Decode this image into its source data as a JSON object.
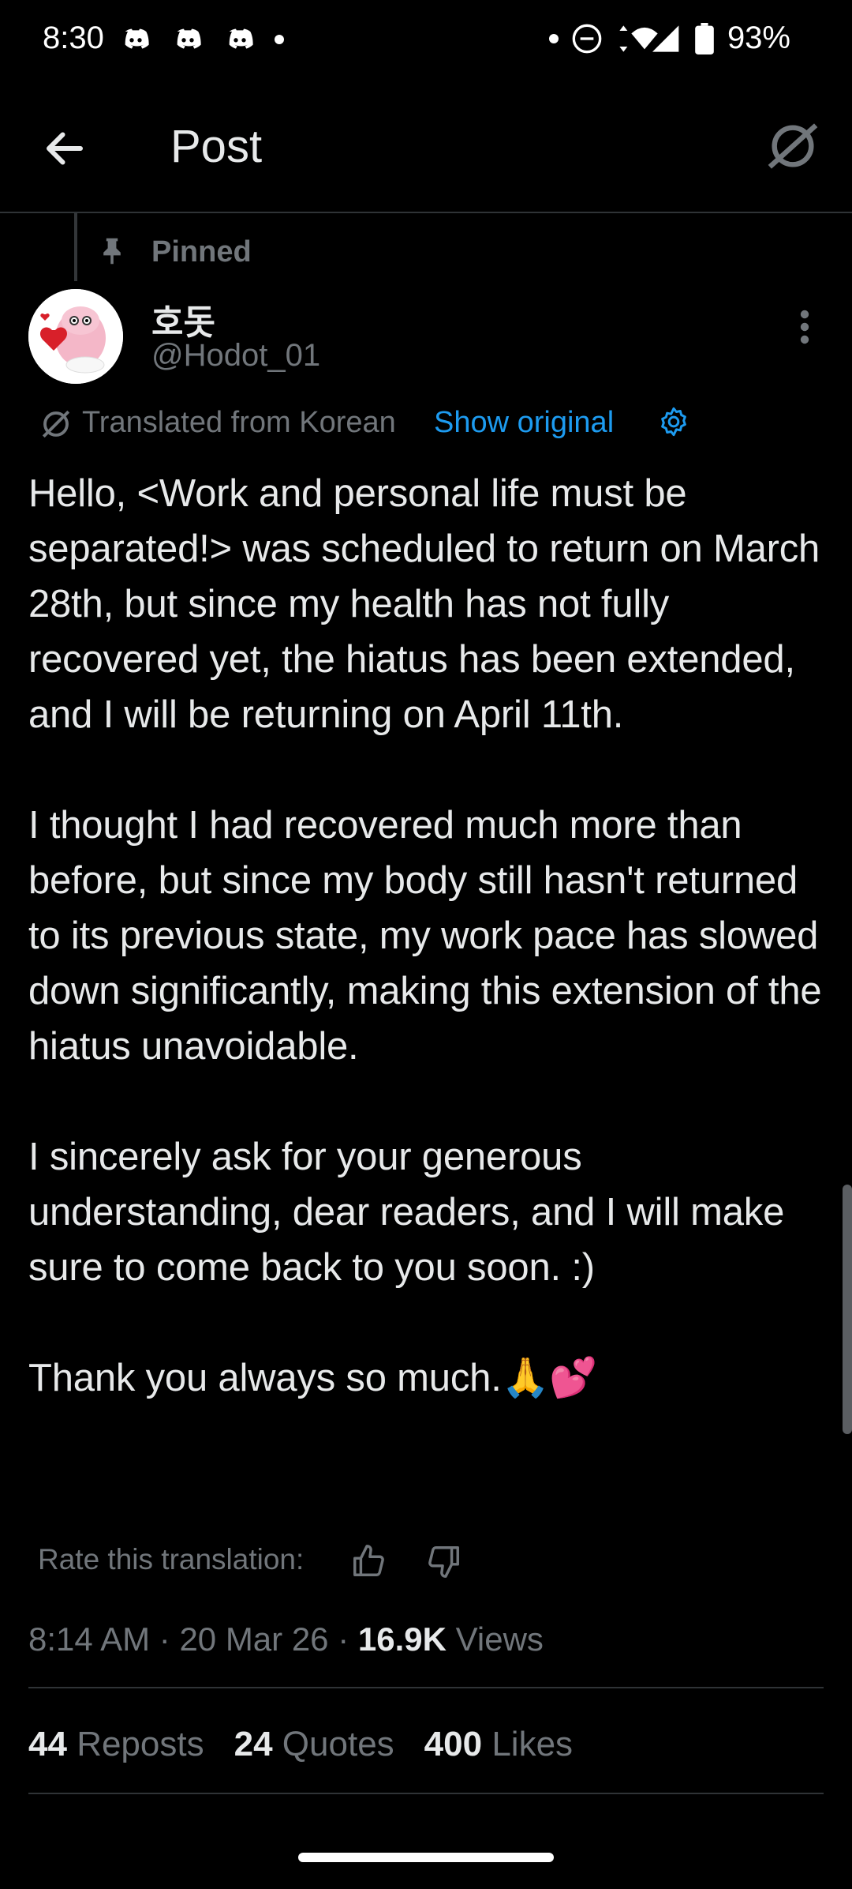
{
  "status_bar": {
    "time": "8:30",
    "battery": "93%"
  },
  "header": {
    "title": "Post",
    "back_icon": "arrow-left-icon",
    "grok_icon": "grok-icon"
  },
  "post": {
    "pinned_label": "Pinned",
    "author": {
      "name": "호돗",
      "handle": "@Hodot_01"
    },
    "translation": {
      "label": "Translated from Korean",
      "show_original": "Show original"
    },
    "text": "Hello, <Work and personal life must be separated!> was scheduled to return on March 28th, but since my health has not fully recovered yet, the hiatus has been extended, and I will be returning on April 11th.\n\nI thought I had recovered much more than before, but since my body still hasn't returned to its previous state, my work pace has slowed down significantly, making this extension of the hiatus unavoidable.\n\nI sincerely ask for your generous understanding, dear readers, and I will make sure to come back to you soon. :)\n\nThank you always so much.🙏💕",
    "rate_label": "Rate this translation:",
    "meta": {
      "time": "8:14 AM",
      "date": "20 Mar 26",
      "views_count": "16.9K",
      "views_label": "Views"
    },
    "stats": {
      "reposts_count": "44",
      "reposts_label": "Reposts",
      "quotes_count": "24",
      "quotes_label": "Quotes",
      "likes_count": "400",
      "likes_label": "Likes"
    }
  },
  "colors": {
    "background": "#000000",
    "text": "#e7e9ea",
    "muted": "#71767b",
    "link": "#1d9bf0",
    "divider": "#2f3336"
  }
}
